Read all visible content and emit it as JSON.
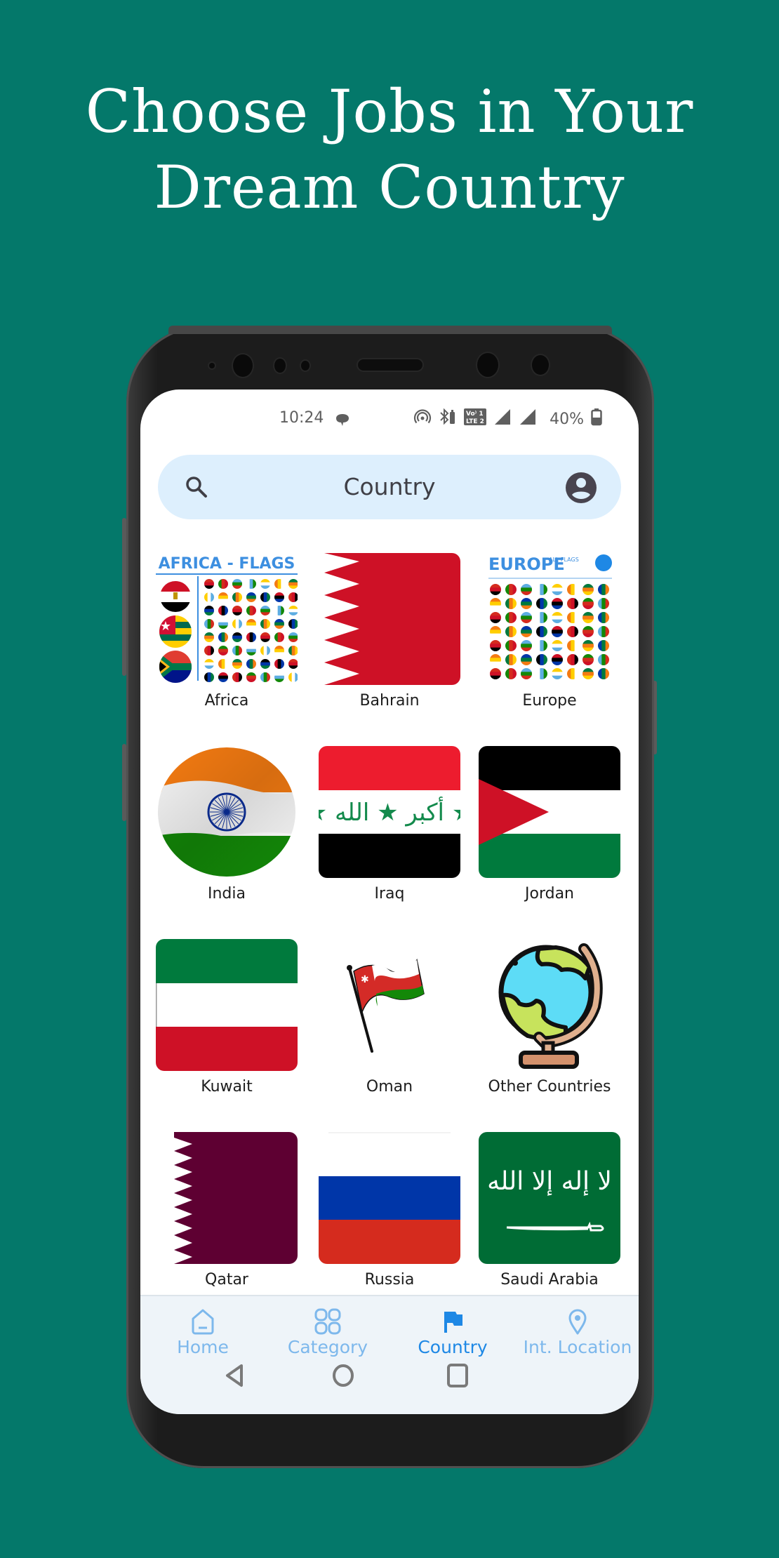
{
  "headline": {
    "line1": "Choose Jobs in Your",
    "line2": "Dream Country"
  },
  "status_bar": {
    "time": "10:24",
    "notification_icon": "message-bubble-icon",
    "icons": [
      "hotspot-icon",
      "bluetooth-battery-icon",
      "volte-lte-icon",
      "signal-sim1-icon",
      "signal-sim2-icon"
    ],
    "battery_percent": "40%"
  },
  "search": {
    "placeholder": "Country",
    "left_icon": "search-icon",
    "right_icon": "account-circle-icon"
  },
  "countries": [
    {
      "label": "Africa",
      "icon": "africa-flags-collage"
    },
    {
      "label": "Bahrain",
      "icon": "bahrain-flag"
    },
    {
      "label": "Europe",
      "icon": "europe-flags-collage"
    },
    {
      "label": "India",
      "icon": "india-flag"
    },
    {
      "label": "Iraq",
      "icon": "iraq-flag"
    },
    {
      "label": "Jordan",
      "icon": "jordan-flag"
    },
    {
      "label": "Kuwait",
      "icon": "kuwait-flag"
    },
    {
      "label": "Oman",
      "icon": "oman-flag"
    },
    {
      "label": "Other Countries",
      "icon": "globe-icon"
    },
    {
      "label": "Qatar",
      "icon": "qatar-flag"
    },
    {
      "label": "Russia",
      "icon": "russia-flag"
    },
    {
      "label": "Saudi Arabia",
      "icon": "saudi-arabia-flag"
    }
  ],
  "collage_text": {
    "africa_title": "AFRICA - FLAGS",
    "europe_title": "EUROPE",
    "europe_subtitle": "ALL FLAGS"
  },
  "bottom_nav": {
    "items": [
      {
        "label": "Home",
        "icon": "home-icon",
        "active": false
      },
      {
        "label": "Category",
        "icon": "grid-icon",
        "active": false
      },
      {
        "label": "Country",
        "icon": "flag-icon",
        "active": true
      },
      {
        "label": "Int. Location",
        "icon": "location-pin-icon",
        "active": false
      }
    ]
  },
  "system_nav": {
    "buttons": [
      "back-icon",
      "home-circle-icon",
      "recents-icon"
    ]
  },
  "colors": {
    "background": "#04786A",
    "search_bg": "#DDEFFD",
    "nav_bg": "#EEF4F9",
    "nav_active": "#1E88E5",
    "nav_inactive": "#7DB8EC"
  }
}
